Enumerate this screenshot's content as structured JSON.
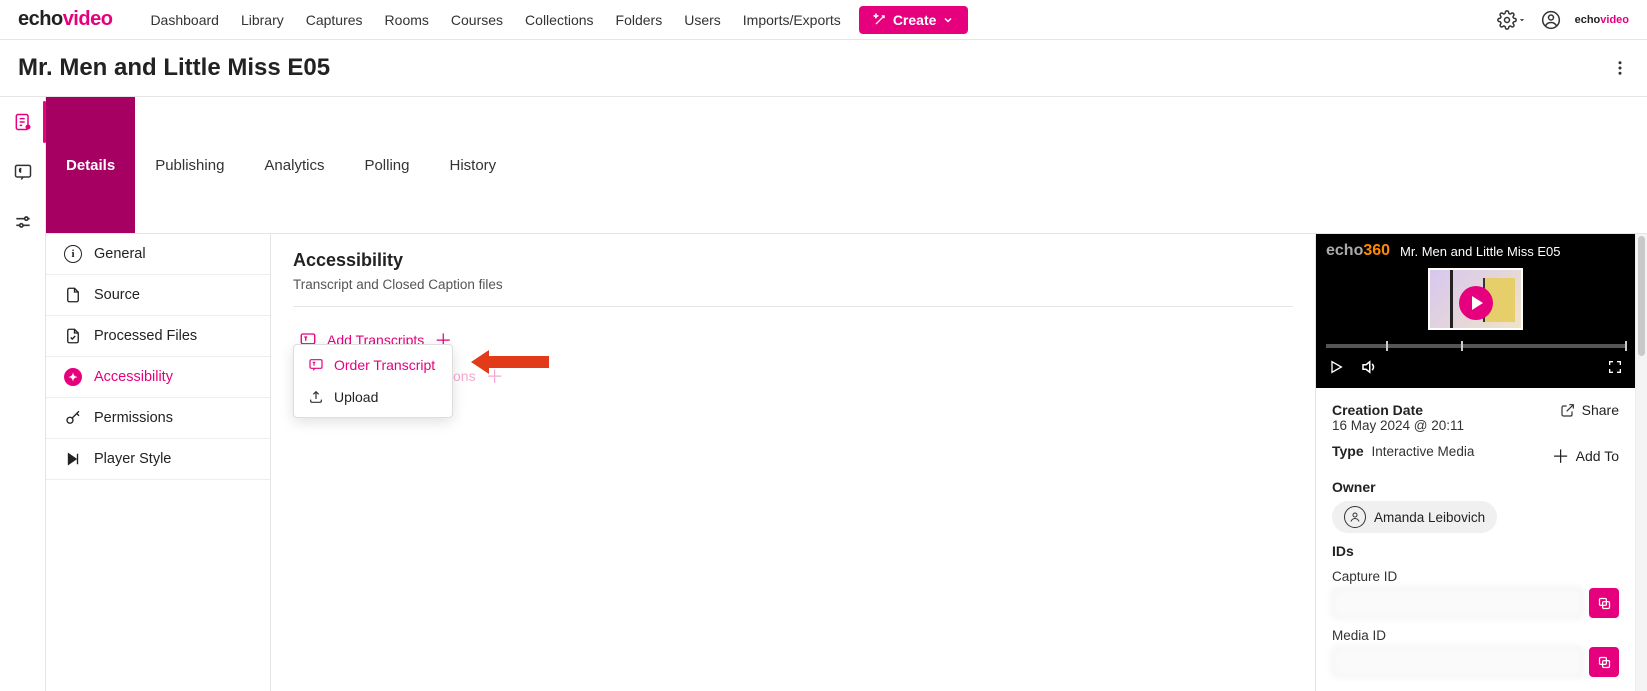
{
  "brand": {
    "part1": "echo",
    "part2": "video"
  },
  "topnav": [
    "Dashboard",
    "Library",
    "Captures",
    "Rooms",
    "Courses",
    "Collections",
    "Folders",
    "Users",
    "Imports/Exports"
  ],
  "create_label": "Create",
  "page_title": "Mr. Men and Little Miss E05",
  "tabs": [
    "Details",
    "Publishing",
    "Analytics",
    "Polling",
    "History"
  ],
  "subnav": [
    {
      "label": "General"
    },
    {
      "label": "Source"
    },
    {
      "label": "Processed Files"
    },
    {
      "label": "Accessibility"
    },
    {
      "label": "Permissions"
    },
    {
      "label": "Player Style"
    }
  ],
  "content": {
    "heading": "Accessibility",
    "sub": "Transcript and Closed Caption files",
    "add_transcripts": "Add Transcripts",
    "add_cc_partial": "ons"
  },
  "dropdown": {
    "order": "Order Transcript",
    "upload": "Upload"
  },
  "player": {
    "brand_a": "echo",
    "brand_b": "360",
    "title": "Mr. Men and Little Miss E05"
  },
  "meta": {
    "creation_label": "Creation Date",
    "creation_value": "16 May 2024 @ 20:11",
    "share": "Share",
    "type_label": "Type",
    "type_value": "Interactive Media",
    "add_to": "Add To",
    "owner_label": "Owner",
    "owner_name": "Amanda Leibovich",
    "ids_label": "IDs",
    "capture_id_label": "Capture ID",
    "media_id_label": "Media ID"
  }
}
